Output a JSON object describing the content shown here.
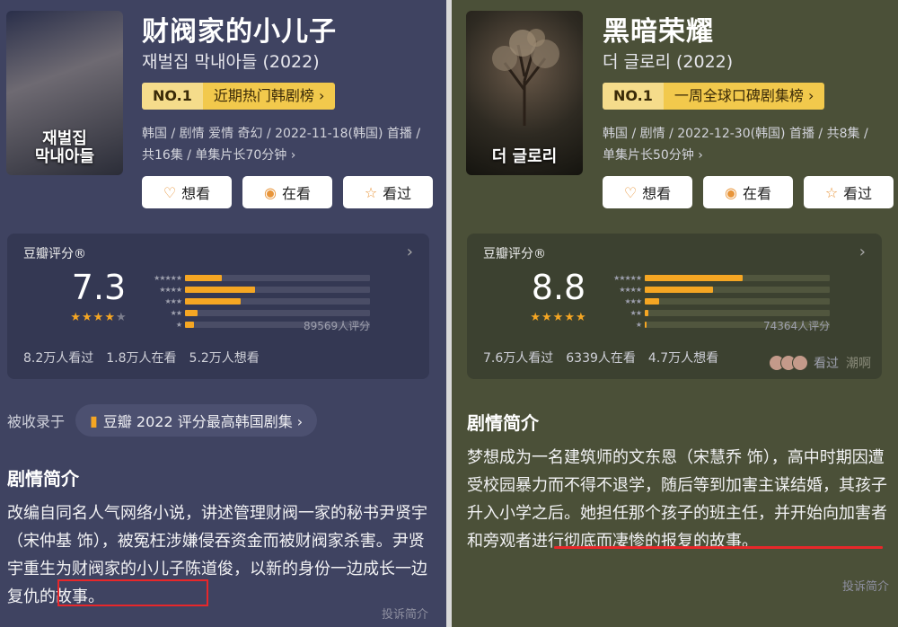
{
  "left": {
    "poster_text": "재벌집\n막내아들",
    "title": "财阀家的小儿子",
    "subtitle": "재벌집 막내아들 (2022)",
    "rank_no": "NO.1",
    "rank_label": "近期热门韩剧榜 ›",
    "meta_line1": "韩国 / 剧情 爱情 奇幻 / 2022-11-18(韩国) 首播 /",
    "meta_line2": "共16集 / 单集片长70分钟 ›",
    "buttons": {
      "want": "想看",
      "watching": "在看",
      "watched": "看过"
    },
    "rating_header": "豆瓣评分®",
    "score": "7.3",
    "score_value": 3.5,
    "star_distribution": [
      0.2,
      0.38,
      0.3,
      0.07,
      0.05
    ],
    "rating_count": "89569人评分",
    "stats": [
      "8.2万人看过",
      "1.8万人在看",
      "5.2万人想看"
    ],
    "included_label": "被收录于",
    "included_pill": "豆瓣 2022 评分最高韩国剧集 ›",
    "synopsis_title": "剧情简介",
    "synopsis": "改编自同名人气网络小说，讲述管理财阀一家的秘书尹贤宇（宋仲基 饰），被冤枉涉嫌侵吞资金而被财阀家杀害。尹贤宇重生为财阀家的小儿子陈道俊，以新的身份一边成长一边复仇的故事。",
    "report": "投诉简介"
  },
  "right": {
    "poster_text": "더 글로리",
    "title": "黑暗荣耀",
    "subtitle": "더 글로리 (2022)",
    "rank_no": "NO.1",
    "rank_label": "一周全球口碑剧集榜 ›",
    "meta_line1": "韩国 / 剧情 / 2022-12-30(韩国) 首播 / 共8集 /",
    "meta_line2": "单集片长50分钟 ›",
    "buttons": {
      "want": "想看",
      "watching": "在看",
      "watched": "看过"
    },
    "rating_header": "豆瓣评分®",
    "score": "8.8",
    "score_value": 4.5,
    "star_distribution": [
      0.53,
      0.37,
      0.08,
      0.02,
      0.01
    ],
    "rating_count": "74364人评分",
    "stats": [
      "7.6万人看过",
      "6339人在看",
      "4.7万人想看"
    ],
    "viewed_label": "看过",
    "viewed_extra": "潮啊",
    "synopsis_title": "剧情简介",
    "synopsis": "梦想成为一名建筑师的文东恩（宋慧乔 饰），高中时期因遭受校园暴力而不得不退学，随后等到加害主谋结婚，其孩子升入小学之后。她担任那个孩子的班主任，并开始向加害者和旁观者进行彻底而凄惨的报复的故事。",
    "report": "投诉简介"
  },
  "colors": {
    "accent": "#f5a623",
    "highlight": "#e8272a",
    "rank_bg": "#f2c94c"
  }
}
